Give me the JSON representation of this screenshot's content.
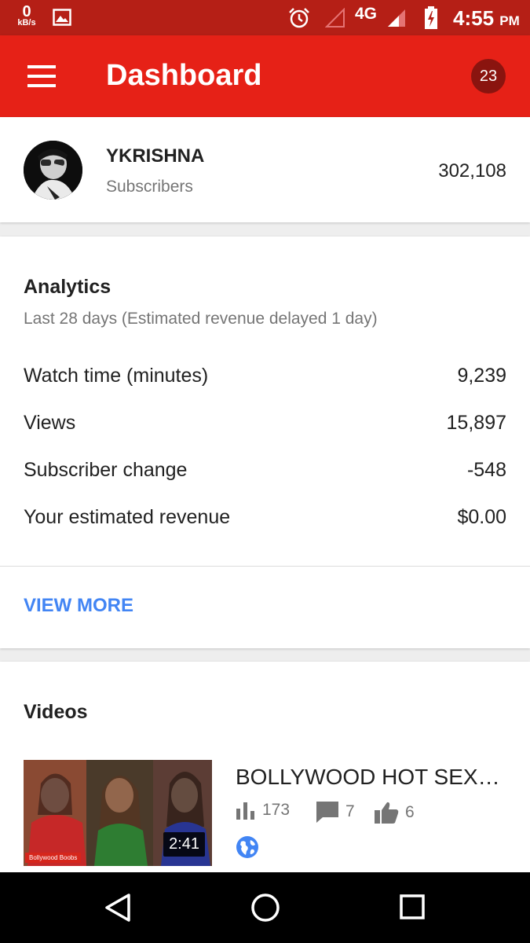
{
  "status_bar": {
    "speed_value": "0",
    "speed_unit": "kB/s",
    "network_type": "4G",
    "time": "4:55",
    "ampm": "PM"
  },
  "app_bar": {
    "title": "Dashboard",
    "notification_count": "23",
    "color": "#e62117"
  },
  "channel": {
    "name": "YKRISHNA",
    "subscribers_label": "Subscribers",
    "subscribers_count": "302,108"
  },
  "analytics": {
    "title": "Analytics",
    "subtitle": "Last 28 days (Estimated revenue delayed 1 day)",
    "metrics": [
      {
        "label": "Watch time (minutes)",
        "value": "9,239"
      },
      {
        "label": "Views",
        "value": "15,897"
      },
      {
        "label": "Subscriber change",
        "value": "-548"
      },
      {
        "label": "Your estimated revenue",
        "value": "$0.00"
      }
    ],
    "view_more": "VIEW MORE",
    "link_color": "#4285f4"
  },
  "videos": {
    "title": "Videos",
    "items": [
      {
        "title": "BOLLYWOOD HOT SEXY...",
        "duration": "2:41",
        "thumb_caption": "Bollywood Boobs",
        "views": "173",
        "comments": "7",
        "likes": "6",
        "privacy_icon": "globe-icon"
      }
    ]
  },
  "nav_bar": {
    "icons": [
      "back-icon",
      "home-icon",
      "recents-icon"
    ]
  }
}
